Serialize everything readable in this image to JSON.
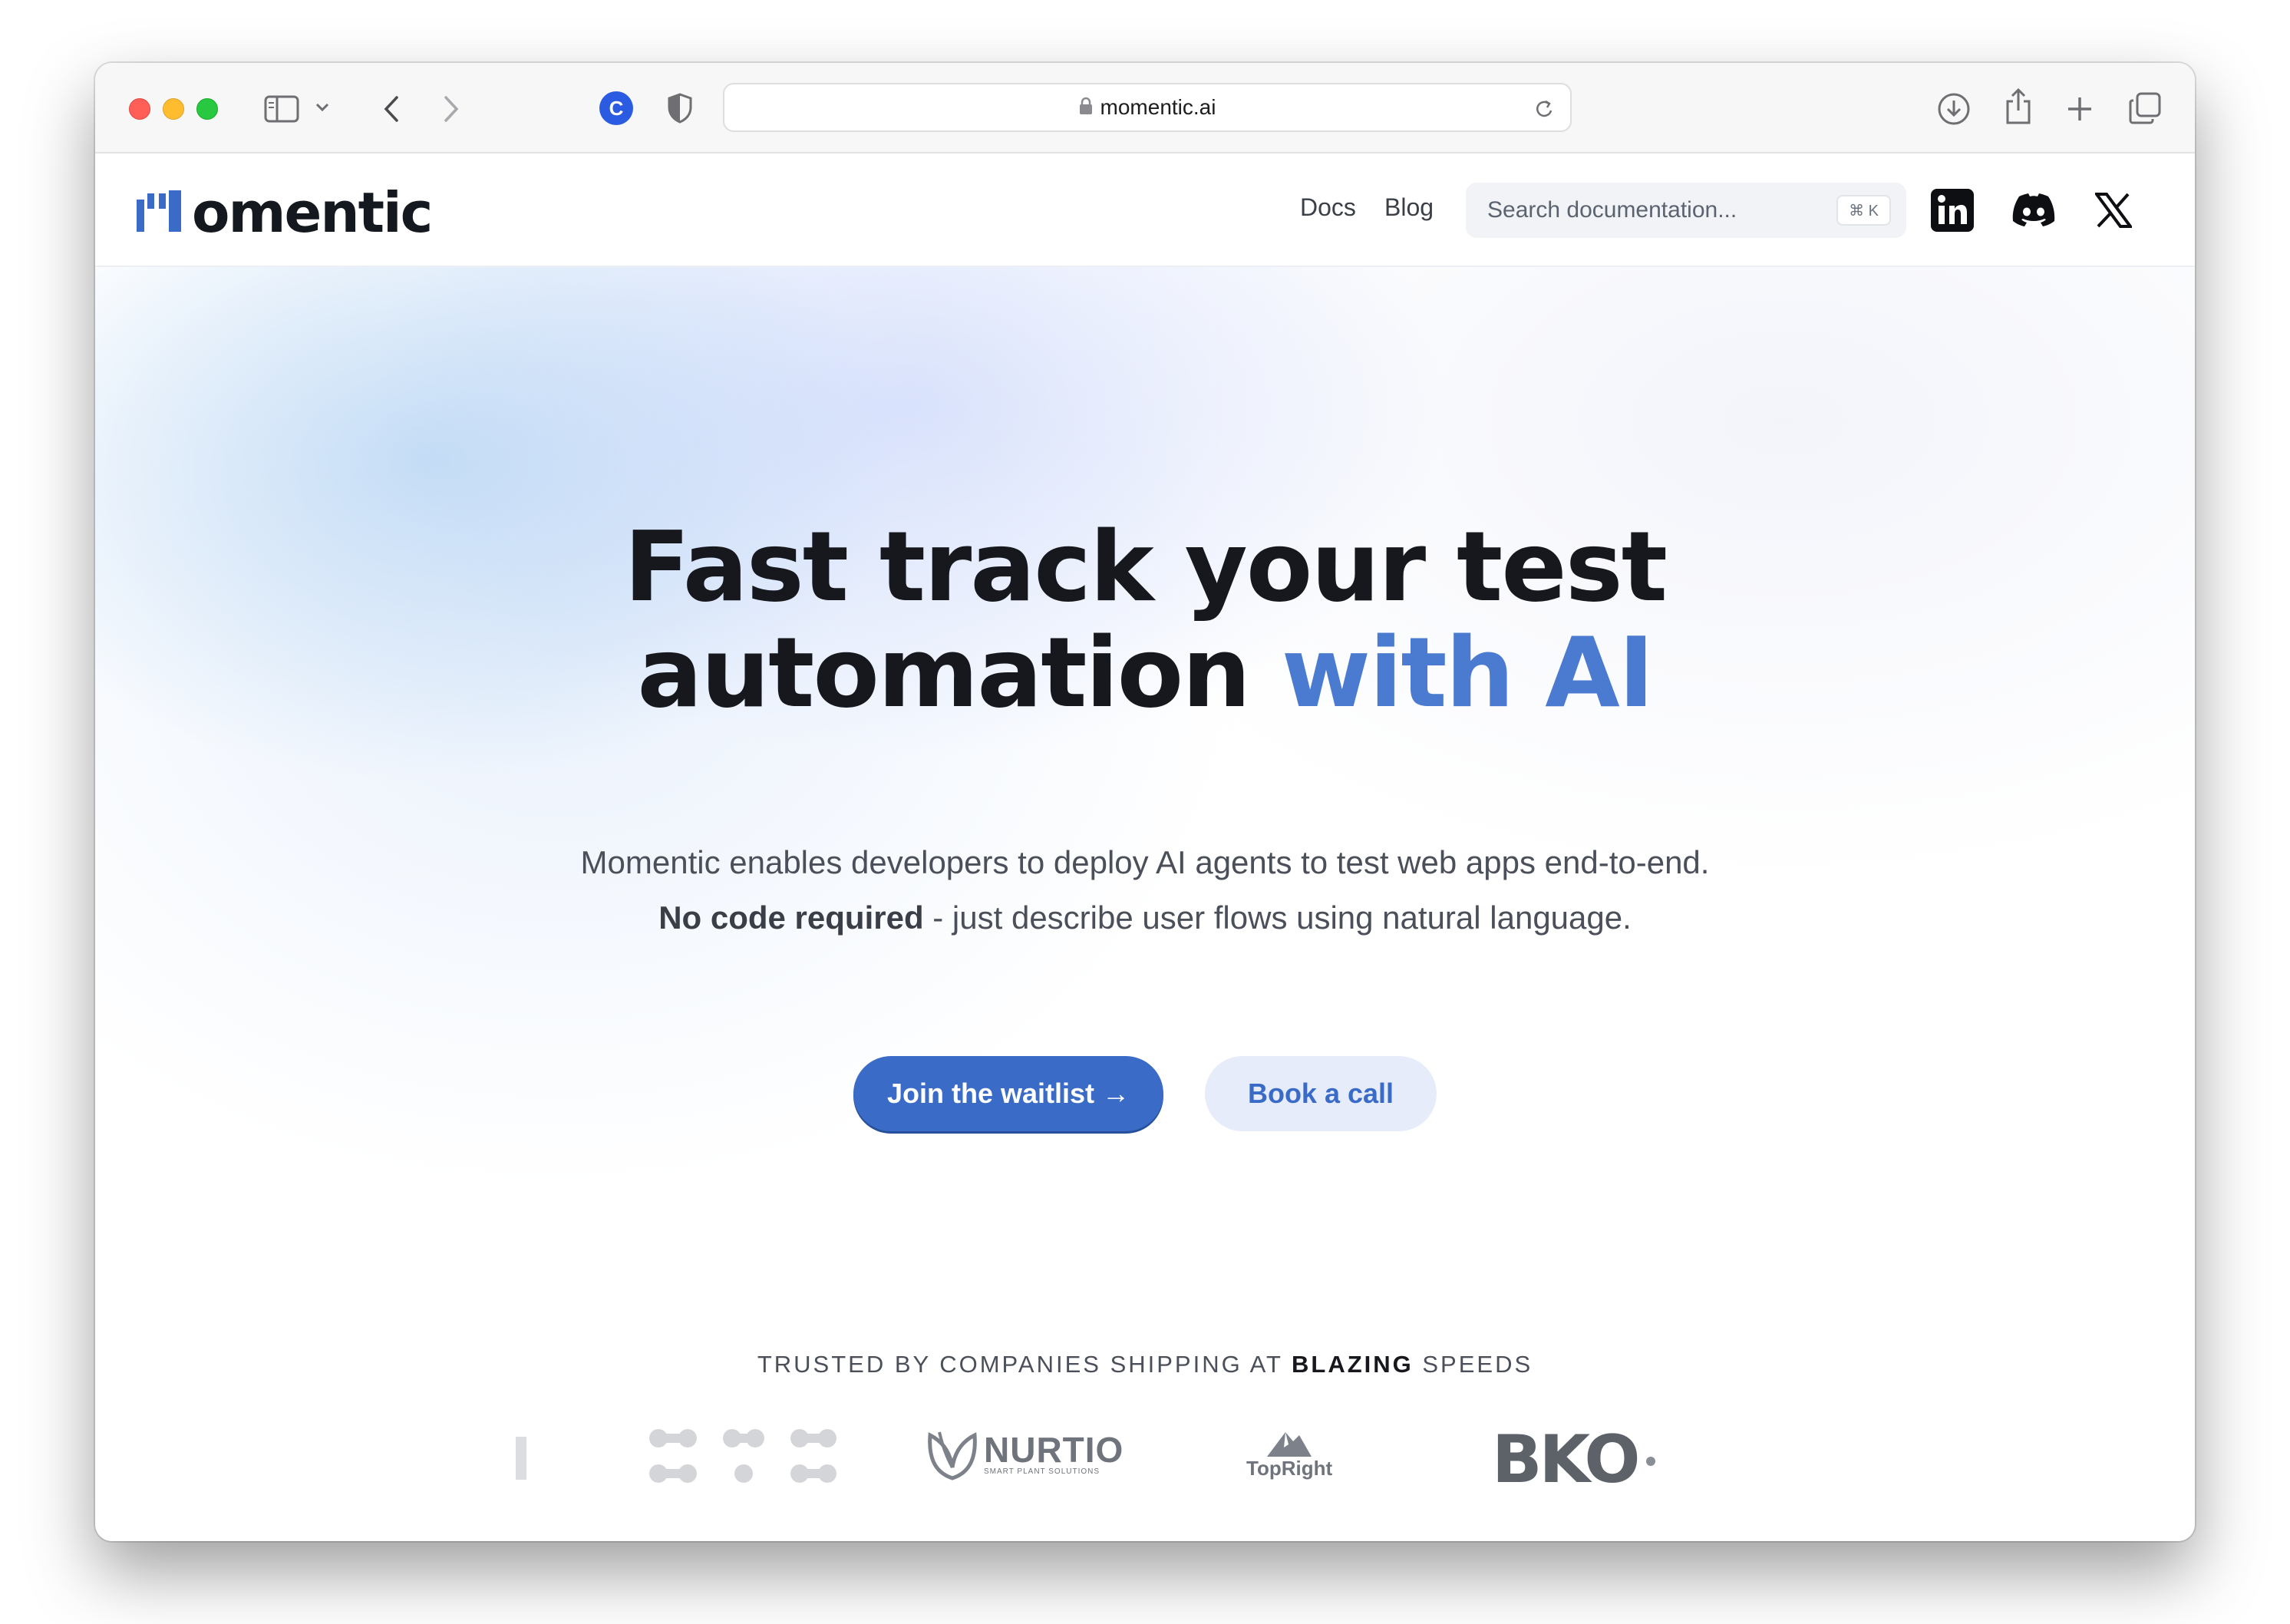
{
  "browser": {
    "url": "momentic.ai",
    "icons": [
      "sidebar-icon",
      "chevron-down-icon",
      "back-icon",
      "forward-icon",
      "extension-c-icon",
      "shield-icon",
      "lock-icon",
      "reload-icon",
      "download-icon",
      "share-icon",
      "new-tab-icon",
      "tabs-icon"
    ]
  },
  "site": {
    "logo_text": "omentic",
    "nav": {
      "docs": "Docs",
      "blog": "Blog"
    },
    "search": {
      "placeholder": "Search documentation...",
      "shortcut": "⌘ K"
    },
    "social": [
      "linkedin-icon",
      "discord-icon",
      "x-icon"
    ]
  },
  "hero": {
    "headline_line1": "Fast track your test",
    "headline_line2_main": "automation",
    "headline_line2_accent": "with AI",
    "sub_line1": "Momentic enables developers to deploy AI agents to test web apps end-to-end.",
    "sub_line2_bold": "No code required",
    "sub_line2_rest": " - just describe user flows using natural language.",
    "primary_cta": "Join the waitlist →",
    "secondary_cta": "Book a call"
  },
  "trusted": {
    "prefix": "TRUSTED BY COMPANIES SHIPPING AT ",
    "highlight": "BLAZING",
    "suffix": " SPEEDS",
    "companies": {
      "nurtio": "NURTIO",
      "nurtio_tagline": "SMART PLANT SOLUTIONS",
      "topright": "TopRight",
      "bko": "BKO"
    }
  },
  "colors": {
    "accent": "#3a6cc7",
    "headline_accent": "#4a7bd0",
    "text_dark": "#16181d"
  }
}
